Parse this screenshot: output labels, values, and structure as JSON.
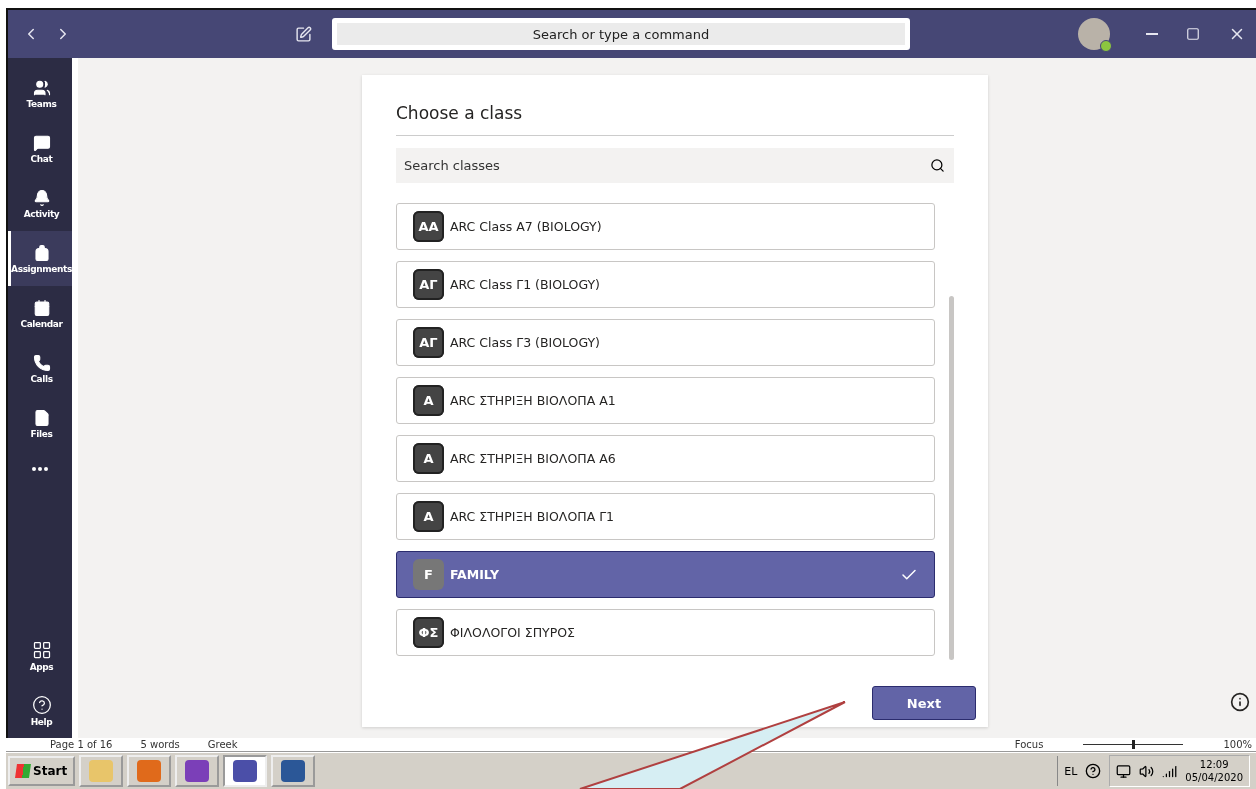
{
  "titlebar": {
    "search_placeholder": "Search or type a command"
  },
  "nav": [
    {
      "label": "Teams",
      "selected": false
    },
    {
      "label": "Chat",
      "selected": false
    },
    {
      "label": "Activity",
      "selected": false
    },
    {
      "label": "Assignments",
      "selected": true
    },
    {
      "label": "Calendar",
      "selected": false
    },
    {
      "label": "Calls",
      "selected": false
    },
    {
      "label": "Files",
      "selected": false
    }
  ],
  "nav_bottom": [
    {
      "label": "Apps"
    },
    {
      "label": "Help"
    }
  ],
  "dialog": {
    "title": "Choose a class",
    "search_placeholder": "Search classes",
    "classes": [
      {
        "initials": "AA",
        "name": "ARC Class A7 (BIOLOGY)",
        "selected": false
      },
      {
        "initials": "ΑΓ",
        "name": "ARC Class Γ1 (BIOLOGY)",
        "selected": false
      },
      {
        "initials": "ΑΓ",
        "name": "ARC Class Γ3 (BIOLOGY)",
        "selected": false
      },
      {
        "initials": "A",
        "name": "ARC ΣΤΗΡΙΞΗ ΒΙΟΛΟΠΑ Α1",
        "selected": false
      },
      {
        "initials": "A",
        "name": "ARC ΣΤΗΡΙΞΗ ΒΙΟΛΟΠΑ Α6",
        "selected": false
      },
      {
        "initials": "A",
        "name": "ARC ΣΤΗΡΙΞΗ ΒΙΟΛΟΠΑ Γ1",
        "selected": false
      },
      {
        "initials": "F",
        "name": "FAMILY",
        "selected": true
      },
      {
        "initials": "ΦΣ",
        "name": "ΦΙΛΟΛΟΓΟΙ ΣΠΥΡΟΣ",
        "selected": false
      }
    ],
    "next_button": "Next"
  },
  "word_status": {
    "left": [
      "Page 1 of 16",
      "5 words",
      "Greek"
    ],
    "focus": "Focus",
    "zoom_slider": {
      "level": 0.5
    },
    "zoom": "100%"
  },
  "taskbar": {
    "start": "Start",
    "language": "EL",
    "time": "12:09",
    "date": "05/04/2020"
  }
}
